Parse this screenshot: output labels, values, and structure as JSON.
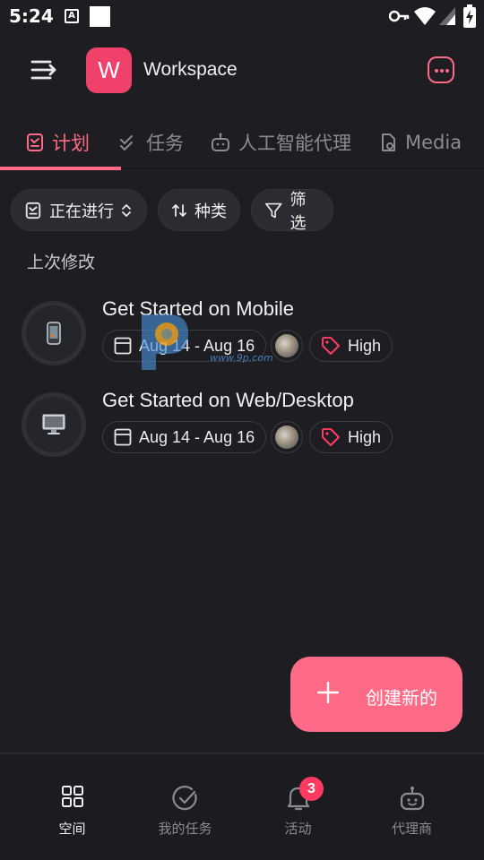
{
  "status_bar": {
    "time": "5:24",
    "a_icon": "A"
  },
  "header": {
    "workspace_initial": "W",
    "workspace_name": "Workspace",
    "accent_color": "#f0416a"
  },
  "tabs": [
    {
      "label": "计划",
      "icon": "plan-icon",
      "active": true
    },
    {
      "label": "任务",
      "icon": "check-icon",
      "active": false
    },
    {
      "label": "人工智能代理",
      "icon": "robot-icon",
      "active": false
    },
    {
      "label": "Media",
      "icon": "media-icon",
      "active": false
    }
  ],
  "filters": {
    "status": "正在进行",
    "sort": "种类",
    "filter": "筛选"
  },
  "section_label": "上次修改",
  "items": [
    {
      "title": "Get Started on Mobile",
      "date_range": "Aug 14 - Aug 16",
      "priority": "High",
      "icon": "mobile-icon"
    },
    {
      "title": "Get Started on Web/Desktop",
      "date_range": "Aug 14 - Aug 16",
      "priority": "High",
      "icon": "desktop-icon"
    }
  ],
  "watermark": {
    "text": "www.9p.com"
  },
  "fab": {
    "label": "创建新的"
  },
  "bottom_nav": [
    {
      "label": "空间",
      "icon": "grid-icon",
      "active": true
    },
    {
      "label": "我的任务",
      "icon": "check-circle-icon",
      "active": false
    },
    {
      "label": "活动",
      "icon": "bell-icon",
      "active": false,
      "badge": "3"
    },
    {
      "label": "代理商",
      "icon": "robot-icon",
      "active": false
    }
  ],
  "colors": {
    "accent": "#ff6b86",
    "background": "#1d1d22",
    "chip": "#2b2c31",
    "badge": "#ff3b5f"
  }
}
